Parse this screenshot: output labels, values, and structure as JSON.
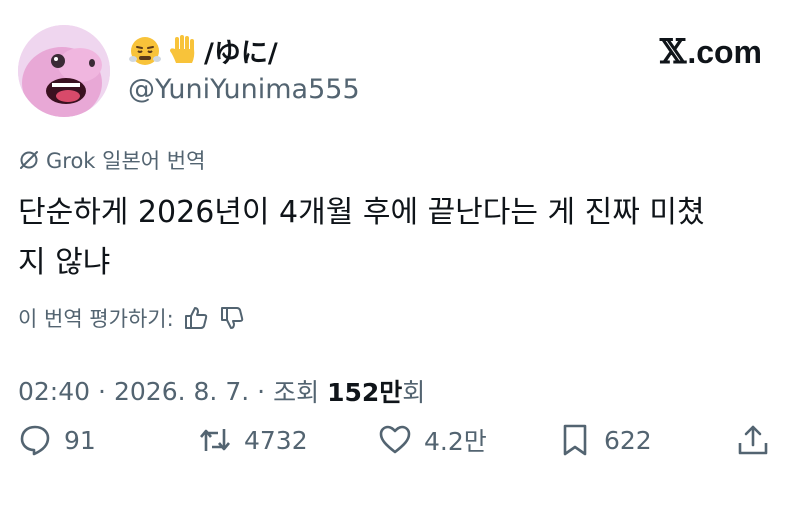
{
  "user": {
    "display_name": "/ゆに/",
    "handle": "@YuniYunima555",
    "name_emojis": [
      "face-with-steam-icon",
      "raised-hand-icon"
    ]
  },
  "brand": {
    "x_mark": "𝕏",
    "suffix": ".com"
  },
  "translation": {
    "label": "Grok 일본어 번역",
    "icon": "grok-icon"
  },
  "tweet": {
    "text": "단순하게 2026년이 4개월 후에 끝난다는 게 진짜 미쳤\n지 않냐"
  },
  "rate": {
    "label": "이 번역 평가하기:",
    "icons": [
      "thumbs-up-icon",
      "thumbs-down-icon"
    ]
  },
  "meta": {
    "time": "02:40",
    "separator": "·",
    "date": "2026. 8. 7.",
    "views_label": "조회",
    "views_count": "152만",
    "views_suffix": "회"
  },
  "actions": {
    "replies": "91",
    "retweets": "4732",
    "likes": "4.2만",
    "bookmarks": "622"
  },
  "colors": {
    "text_primary": "#0f1419",
    "text_secondary": "#536471",
    "avatar_bg": "#efd6ef"
  }
}
